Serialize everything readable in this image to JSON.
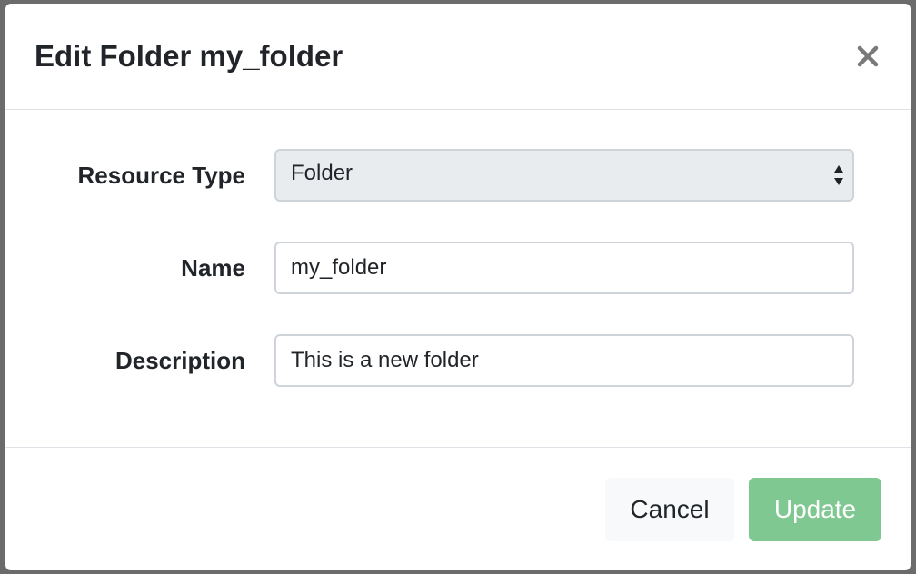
{
  "modal": {
    "title": "Edit Folder my_folder",
    "close_icon": "close-icon"
  },
  "form": {
    "resource_type": {
      "label": "Resource Type",
      "value": "Folder",
      "options": [
        "Folder"
      ]
    },
    "name": {
      "label": "Name",
      "value": "my_folder"
    },
    "description": {
      "label": "Description",
      "value": "This is a new folder"
    }
  },
  "footer": {
    "cancel_label": "Cancel",
    "update_label": "Update"
  },
  "colors": {
    "update_button": "#80c891",
    "cancel_button": "#f8f9fa",
    "select_background": "#e9ecef",
    "border": "#ced4da"
  }
}
